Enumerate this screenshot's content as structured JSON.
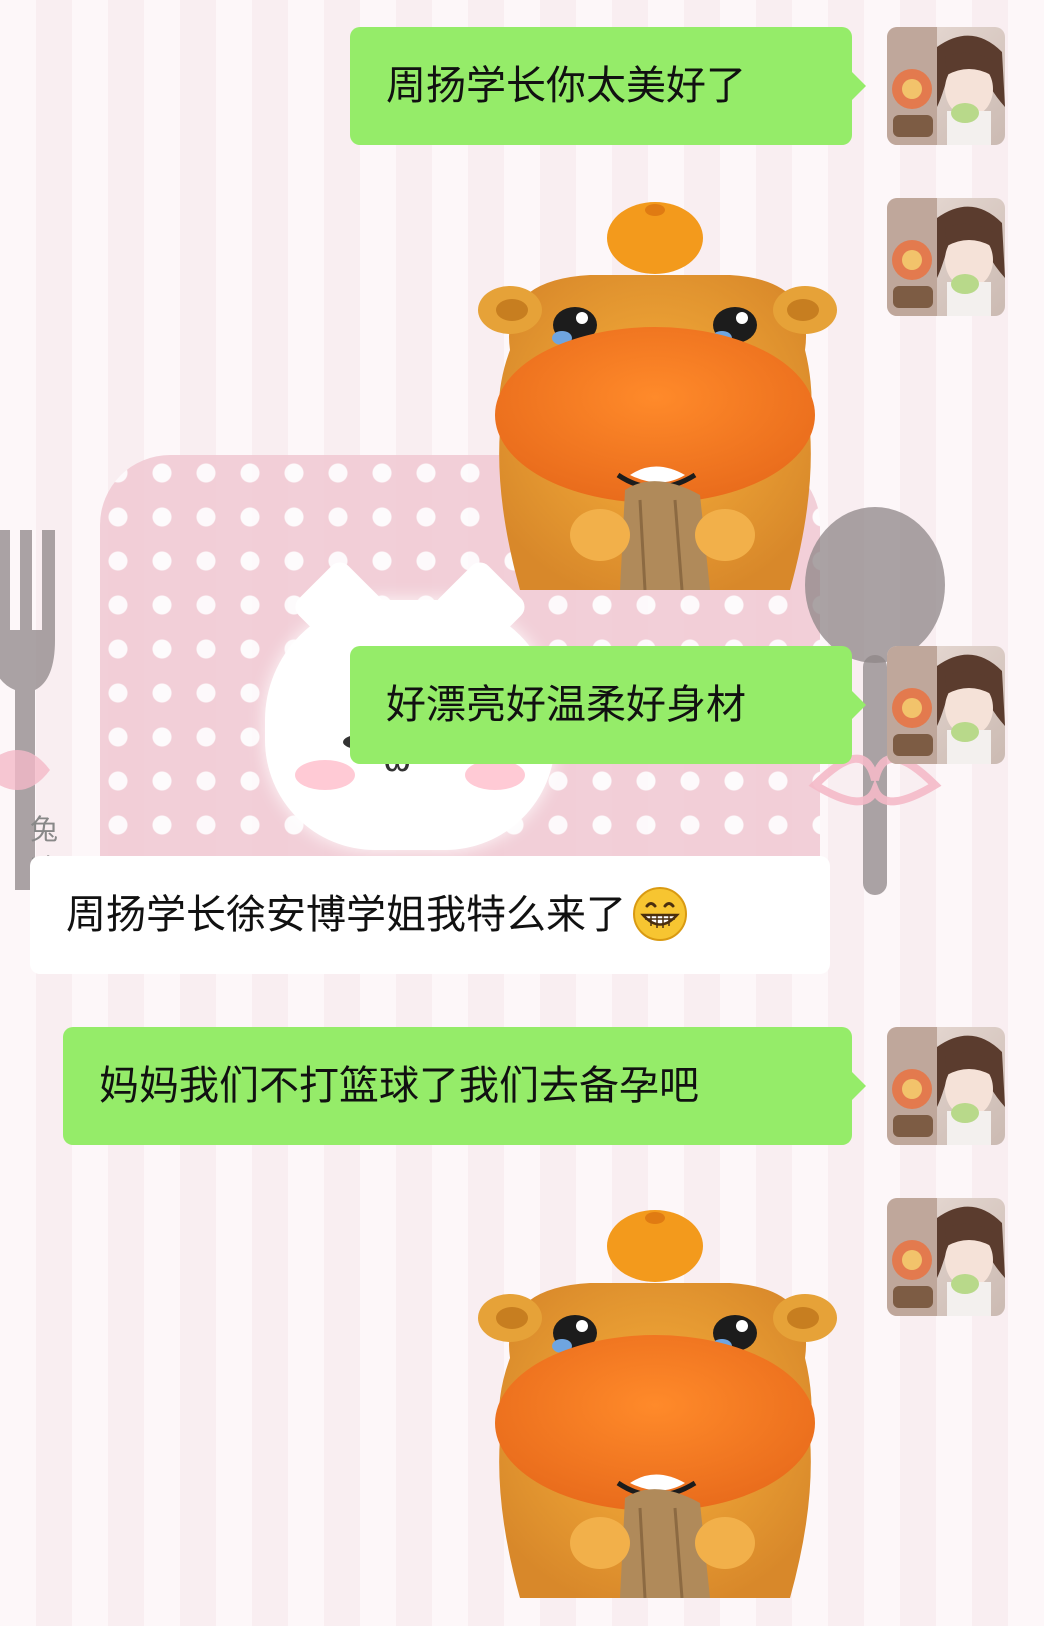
{
  "wallpaper": {
    "stripe_colors": [
      "#fdf7f9",
      "#f9eef1"
    ],
    "card_color": "#f1c9d3"
  },
  "messages": [
    {
      "direction": "outgoing",
      "type": "text",
      "text": "周扬学长你太美好了"
    },
    {
      "direction": "outgoing",
      "type": "sticker",
      "sticker": "crying-capybara-sticker"
    },
    {
      "direction": "outgoing",
      "type": "text",
      "text": "好漂亮好温柔好身材"
    },
    {
      "direction": "incoming",
      "type": "text",
      "sender": "兔咪",
      "text": "周扬学长徐安博学姐我特么来了",
      "emoji": "grinning-face-emoji"
    },
    {
      "direction": "outgoing",
      "type": "text",
      "text": "妈妈我们不打篮球了我们去备孕吧"
    },
    {
      "direction": "outgoing",
      "type": "sticker",
      "sticker": "crying-capybara-sticker"
    }
  ],
  "colors": {
    "outgoing_bubble": "#95ec69",
    "incoming_bubble": "#ffffff",
    "sender_name": "#888888"
  }
}
